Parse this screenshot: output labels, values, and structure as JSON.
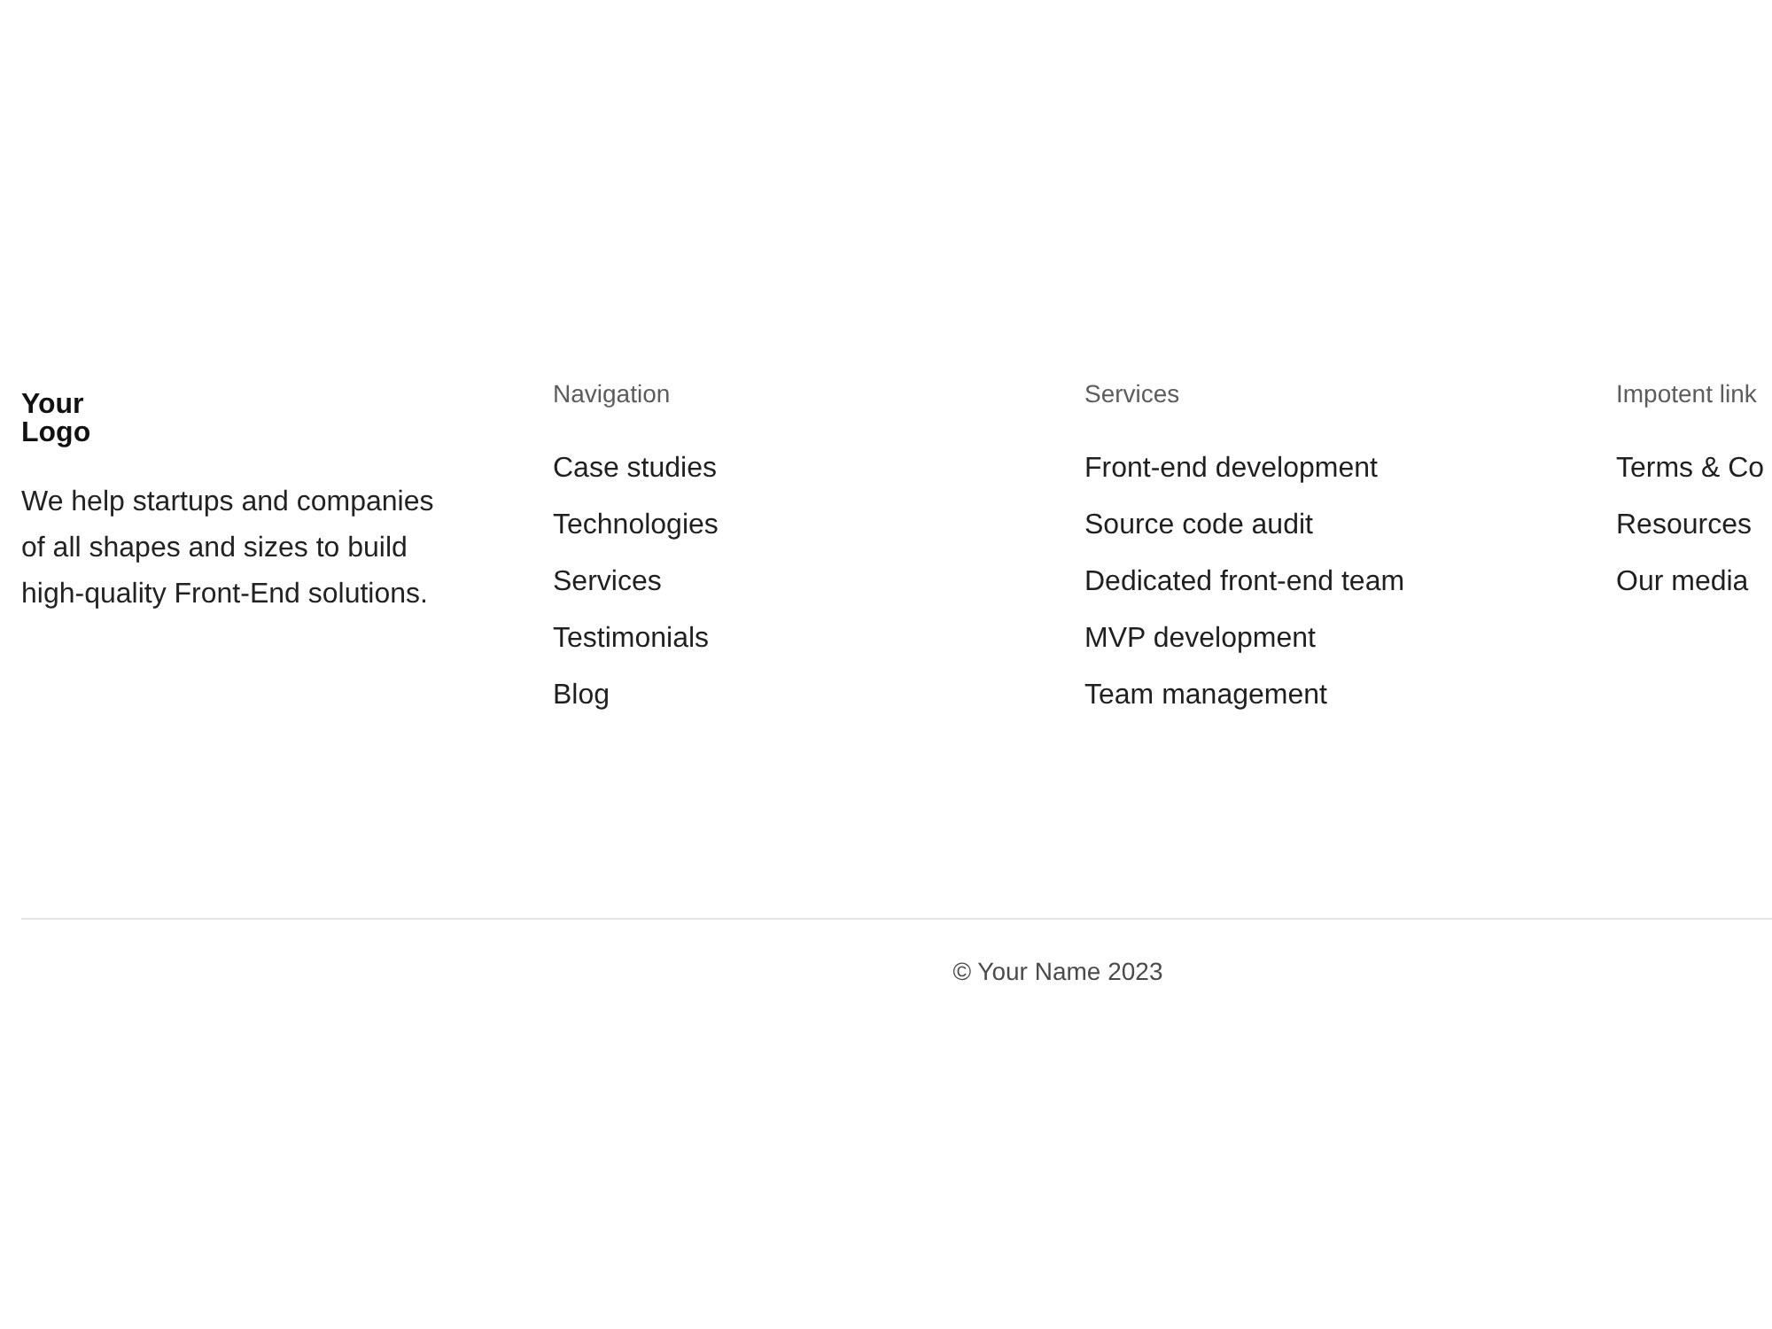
{
  "brand": {
    "logo": "Your Logo",
    "description": "We help startups and companies of all shapes and sizes to build high-quality Front-End solutions."
  },
  "columns": [
    {
      "heading": "Navigation",
      "links": [
        "Case studies",
        "Technologies",
        "Services",
        "Testimonials",
        "Blog"
      ]
    },
    {
      "heading": "Services",
      "links": [
        "Front-end development",
        "Source code audit",
        "Dedicated front-end team",
        "MVP development",
        "Team management"
      ]
    },
    {
      "heading": "Impotent link",
      "links": [
        "Terms & Co",
        "Resources",
        "Our media"
      ]
    }
  ],
  "copyright": "© Your Name 2023"
}
